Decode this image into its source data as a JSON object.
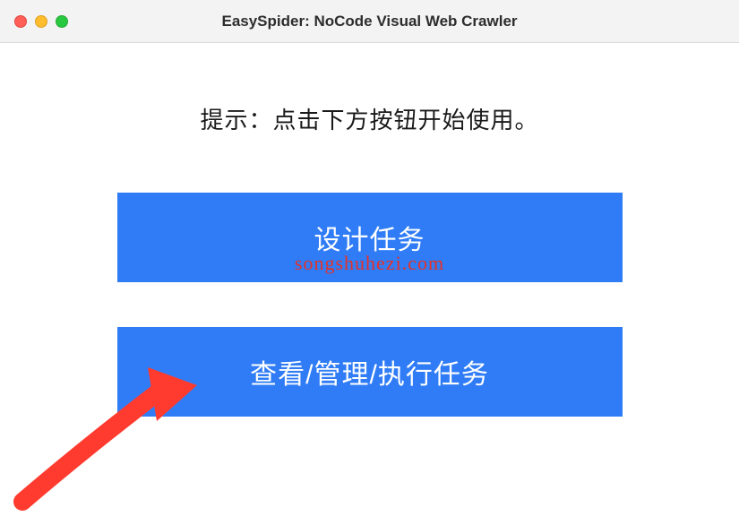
{
  "window": {
    "title": "EasySpider: NoCode Visual Web Crawler"
  },
  "main": {
    "hint": "提示：点击下方按钮开始使用。",
    "buttons": {
      "design_label": "设计任务",
      "manage_label": "查看/管理/执行任务"
    },
    "watermark": "songshuhezi.com"
  }
}
